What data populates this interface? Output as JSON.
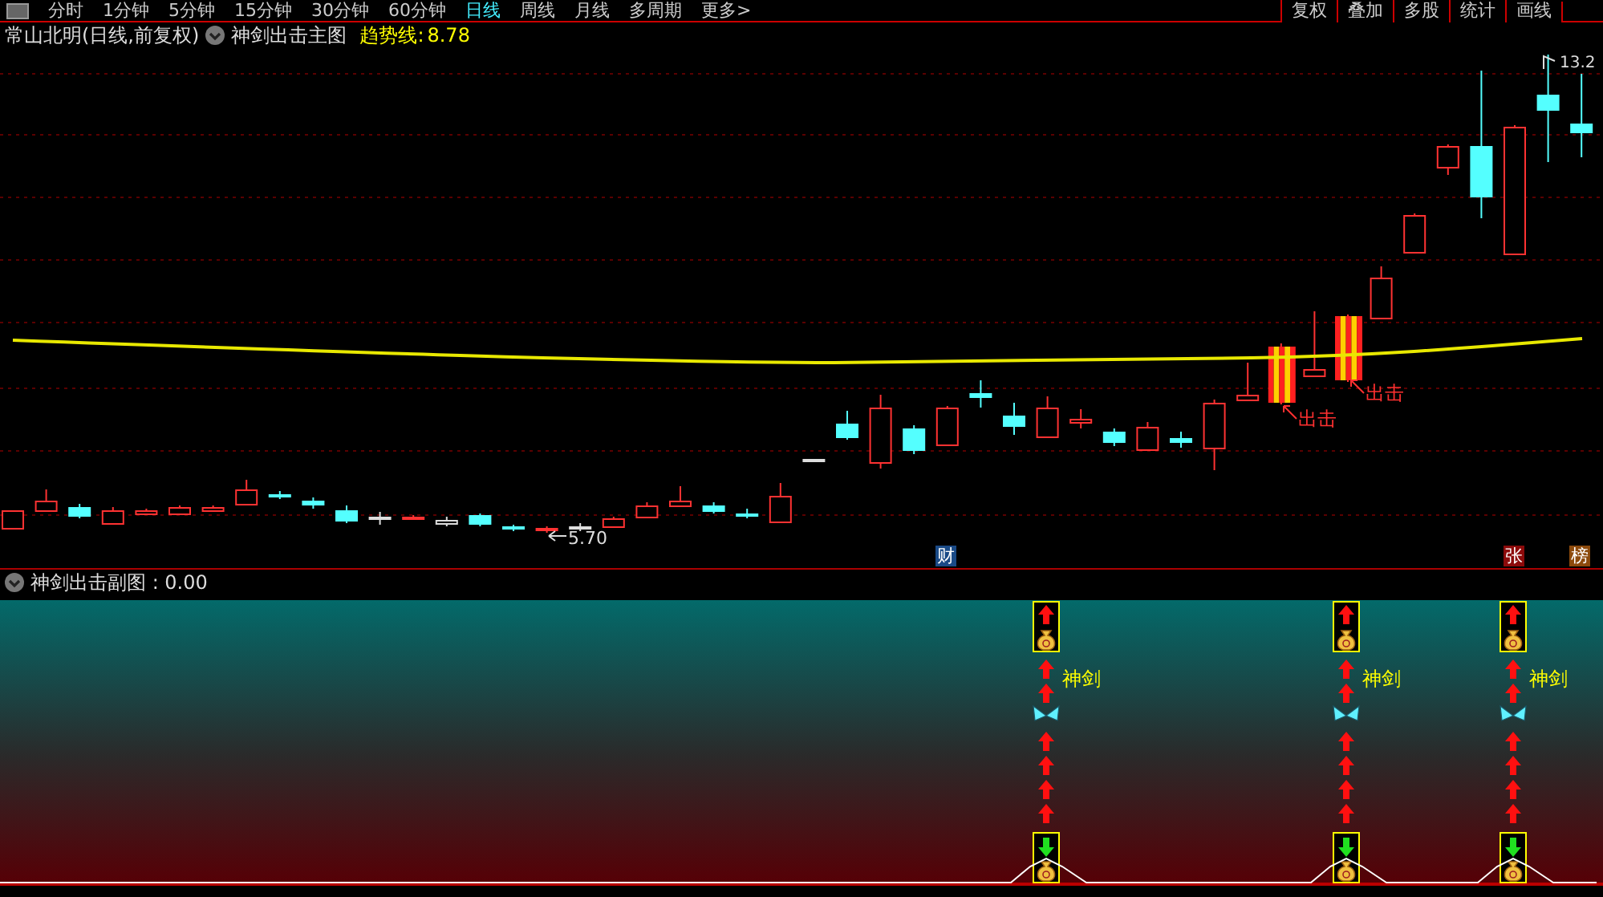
{
  "toolbar": {
    "periods": [
      {
        "label": "分时",
        "selected": false
      },
      {
        "label": "1分钟",
        "selected": false
      },
      {
        "label": "5分钟",
        "selected": false
      },
      {
        "label": "15分钟",
        "selected": false
      },
      {
        "label": "30分钟",
        "selected": false
      },
      {
        "label": "60分钟",
        "selected": false
      },
      {
        "label": "日线",
        "selected": true
      },
      {
        "label": "周线",
        "selected": false
      },
      {
        "label": "月线",
        "selected": false
      },
      {
        "label": "多周期",
        "selected": false
      },
      {
        "label": "更多>",
        "selected": false
      }
    ],
    "buttons": [
      "复权",
      "叠加",
      "多股",
      "统计",
      "画线"
    ]
  },
  "main_chart": {
    "title": "常山北明(日线,前复权)",
    "indicator": "神剑出击主图",
    "trend_label": "趋势线:",
    "trend_value": "8.78",
    "high_label": "13.2",
    "low_label": "5.70",
    "signals": [
      "出击",
      "出击"
    ],
    "events": [
      {
        "text": "财",
        "color": "#1a4a86"
      },
      {
        "text": "张",
        "color": "#8c0a0a"
      },
      {
        "text": "榜",
        "color": "#8c4a0c"
      }
    ]
  },
  "sub_chart": {
    "title": "神剑出击副图 : 0.00",
    "signals": [
      {
        "label": "神剑"
      },
      {
        "label": "神剑"
      },
      {
        "label": "神剑"
      }
    ]
  }
}
